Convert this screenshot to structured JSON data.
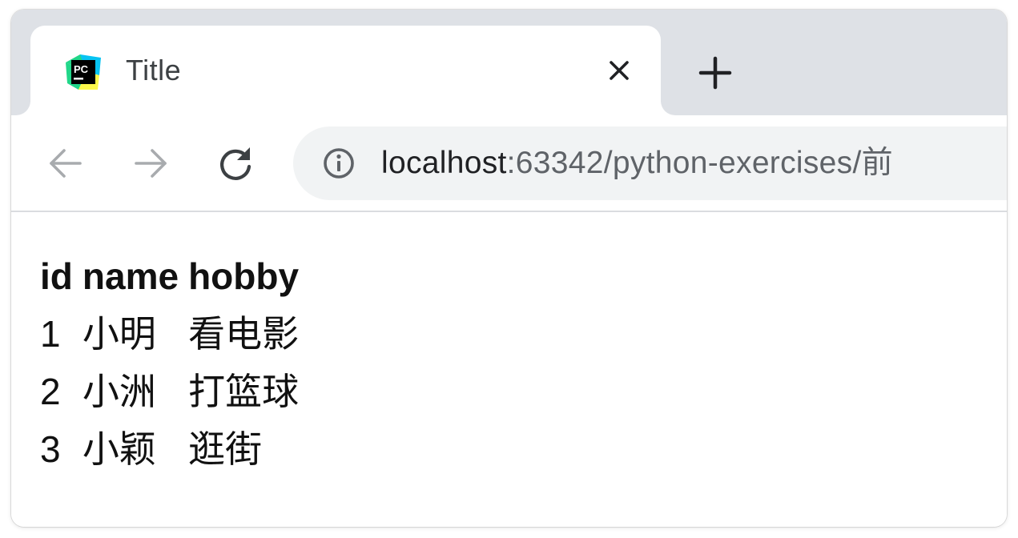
{
  "browser": {
    "tab": {
      "title": "Title",
      "favicon": "pycharm-icon",
      "close_icon": "close-icon"
    },
    "new_tab_icon": "plus-icon",
    "nav": {
      "back_icon": "back-arrow-icon",
      "forward_icon": "forward-arrow-icon",
      "reload_icon": "reload-icon"
    },
    "address": {
      "info_icon": "info-icon",
      "host": "localhost",
      "rest": ":63342/python-exercises/前"
    }
  },
  "table": {
    "headers": [
      "id",
      "name",
      "hobby"
    ],
    "rows": [
      [
        "1",
        "小明",
        "看电影"
      ],
      [
        "2",
        "小洲",
        "打篮球"
      ],
      [
        "3",
        "小颖",
        "逛街"
      ]
    ]
  },
  "colors": {
    "tab_strip": "#dee1e6",
    "omnibox_bg": "#f1f3f4",
    "disabled_nav": "#a8abae",
    "text": "#111111"
  }
}
